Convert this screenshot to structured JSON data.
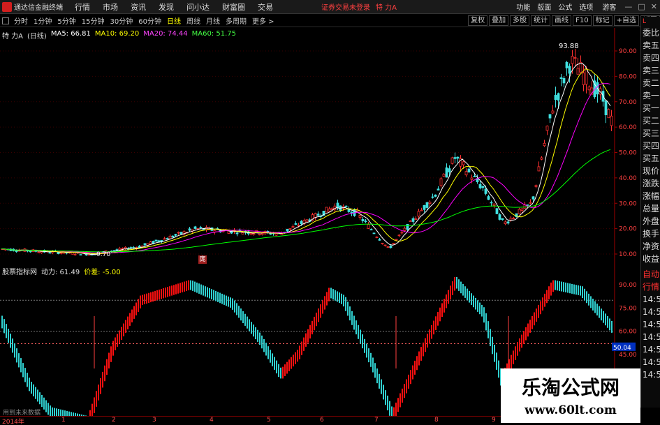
{
  "app": {
    "title": "通达信金融终端",
    "menu": [
      "行情",
      "市场",
      "资讯",
      "发现",
      "问小达",
      "财富圈",
      "交易"
    ],
    "trade_status": "证券交易未登录",
    "stock_title": "特 力A",
    "right_menu": [
      "功能",
      "版面",
      "公式",
      "选项"
    ],
    "guest": "游客",
    "win_buttons": [
      "—",
      "□",
      "✕"
    ],
    "logo_icon": "tdx-logo-icon"
  },
  "periods": {
    "tabs": [
      "分时",
      "1分钟",
      "5分钟",
      "15分钟",
      "30分钟",
      "60分钟",
      "日线",
      "周线",
      "月线",
      "多周期",
      "更多 >"
    ],
    "active": "日线",
    "tools": [
      "复权",
      "叠加",
      "多股",
      "统计",
      "画线",
      "F10",
      "标记",
      "+自选",
      "返回"
    ]
  },
  "kline": {
    "stock": "特 力A",
    "period": "(日线)",
    "ma5": "MA5: 66.81",
    "ma10": "MA10: 69.20",
    "ma20": "MA20: 74.44",
    "ma60": "MA60: 51.75",
    "high_mark": "93.88",
    "low_mark": "9.70",
    "badge": "庞",
    "y_ticks": [
      "90.00",
      "80.00",
      "70.00",
      "60.00",
      "50.00",
      "40.00",
      "30.00",
      "20.00",
      "10.00"
    ],
    "colors": {
      "ma5": "#ffffff",
      "ma10": "#ffff00",
      "ma20": "#ff00ff",
      "ma60": "#00ff00",
      "up": "#ff3030",
      "down": "#40e0e0"
    }
  },
  "indicator": {
    "name": "股票指标网",
    "power": "动力: 61.49",
    "diff": "价差: -5.00",
    "y_ticks": [
      "90.00",
      "75.00",
      "60.00",
      "45.00"
    ],
    "current_value": "50.04",
    "warning": "用到未来数据",
    "colors": {
      "rise": "#ff1010",
      "fall": "#30d0d0"
    }
  },
  "time_axis": [
    "2014年",
    "1",
    "2",
    "3",
    "4",
    "5",
    "6",
    "7",
    "8",
    "9"
  ],
  "quote_panel": {
    "top_labels": [
      "L",
      "R"
    ],
    "items": [
      "委比",
      "卖五",
      "卖四",
      "卖三",
      "卖二",
      "卖一",
      "买一",
      "买二",
      "买三",
      "买四",
      "买五",
      "现价",
      "涨跌",
      "涨幅",
      "总量",
      "外盘",
      "换手",
      "净资",
      "收益"
    ],
    "lower": [
      "自动",
      "行情",
      "14:50",
      "14:50",
      "14:50",
      "14:50",
      "14:50",
      "14:50",
      "14:50",
      "14:50"
    ]
  },
  "watermark": {
    "line1": "乐淘公式网",
    "line2": "www.60lt.com"
  }
}
